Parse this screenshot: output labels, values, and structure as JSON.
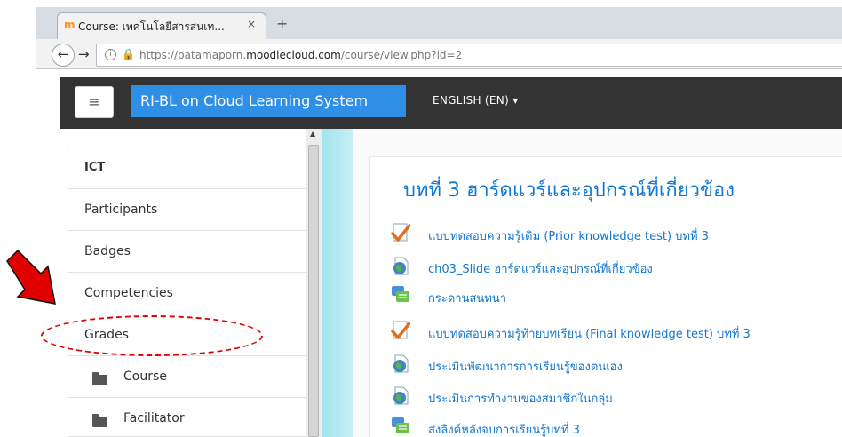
{
  "browser": {
    "tab_title": "Course: เทคโนโลยีสารสนเท...",
    "tab_close": "×",
    "new_tab": "+",
    "url_prefix": "https://patamaporn.",
    "url_domain": "moodlecloud.com",
    "url_path": "/course/view.php?id=2"
  },
  "navbar": {
    "menu_toggle": "≡",
    "brand": "RI-BL on Cloud Learning System",
    "language": "ENGLISH (EN)",
    "language_caret": "▾"
  },
  "sidebar": {
    "items": [
      {
        "label": "ICT",
        "header": true
      },
      {
        "label": "Participants"
      },
      {
        "label": "Badges"
      },
      {
        "label": "Competencies"
      },
      {
        "label": "Grades"
      }
    ],
    "subitems": [
      {
        "label": "Course",
        "icon": "folder-icon"
      },
      {
        "label": "Facilitator",
        "icon": "folder-icon"
      }
    ]
  },
  "section": {
    "title": "บทที่ 3 ฮาร์ดแวร์และอุปกรณ์ที่เกี่ยวข้อง",
    "activities": [
      {
        "label": "แบบทดสอบความรู้เดิม (Prior knowledge test) บทที่ 3",
        "icon": "quiz-check-icon"
      },
      {
        "label": "ch03_Slide ฮาร์ดแวร์และอุปกรณ์ที่เกี่ยวข้อง",
        "icon": "url-globe-icon"
      },
      {
        "label": "กระดานสนทนา",
        "icon": "forum-icon"
      },
      {
        "label": "แบบทดสอบความรู้ท้ายบทเรียน (Final knowledge test) บทที่ 3",
        "icon": "quiz-check-icon"
      },
      {
        "label": "ประเมินพัฒนาการการเรียนรู้ของตนเอง",
        "icon": "url-globe-icon"
      },
      {
        "label": "ประเมินการทำงานของสมาชิกในกลุ่ม",
        "icon": "url-globe-icon"
      },
      {
        "label": "ส่งลิงค์หลังจบการเรียนรู้บทที่ 3",
        "icon": "forum-icon"
      }
    ]
  },
  "colors": {
    "brand_blue": "#2f8ee6",
    "link_blue": "#1177d1",
    "navbar_dark": "#333333",
    "annotation_red": "#e00000"
  }
}
